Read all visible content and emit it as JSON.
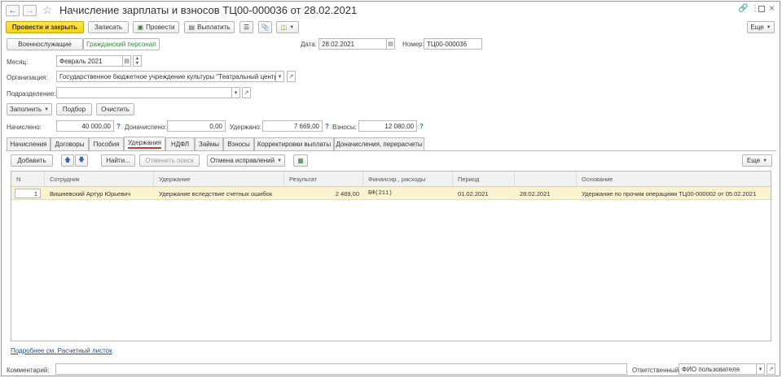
{
  "window": {
    "title": "Начисление зарплаты и взносов ТЦ00-000036 от 28.02.2021"
  },
  "toolbar": {
    "post_close": "Провести и закрыть",
    "save": "Записать",
    "post": "Провести",
    "pay": "Выплатить",
    "more": "Еще"
  },
  "personnel_tabs": {
    "military": "Военнослужащие",
    "civil": "Гражданский персонал"
  },
  "header": {
    "date_label": "Дата:",
    "date_value": "28.02.2021",
    "number_label": "Номер:",
    "number_value": "ТЦ00-000036",
    "month_label": "Месяц:",
    "month_value": "Февраль 2021",
    "org_label": "Организация:",
    "org_value": "Государственное бюджетное учреждение культуры \"Театральный центр\"",
    "dept_label": "Подразделение:",
    "dept_value": ""
  },
  "actions": {
    "fill": "Заполнить",
    "pick": "Подбор",
    "clear": "Очистить"
  },
  "totals": {
    "accrued_label": "Начислено:",
    "accrued_value": "40 000,00",
    "extra_label": "Доначислено:",
    "extra_value": "0,00",
    "withheld_label": "Удержано:",
    "withheld_value": "7 669,00",
    "contrib_label": "Взносы:",
    "contrib_value": "12 080,00",
    "help": "?"
  },
  "tabs": [
    {
      "label": "Начисления"
    },
    {
      "label": "Договоры"
    },
    {
      "label": "Пособия"
    },
    {
      "label": "Удержания"
    },
    {
      "label": "НДФЛ"
    },
    {
      "label": "Займы"
    },
    {
      "label": "Взносы"
    },
    {
      "label": "Корректировки выплаты"
    },
    {
      "label": "Доначисления, перерасчеты"
    }
  ],
  "active_tab": "Удержания",
  "tab_toolbar": {
    "add": "Добавить",
    "find": "Найти...",
    "cancel_search": "Отменить поиск",
    "cancel_corrections": "Отмена исправлений",
    "more": "Еще"
  },
  "table": {
    "columns": [
      "N",
      "Сотрудник",
      "Удержание",
      "Результат",
      "Финансир., расходы",
      "Период",
      "",
      "Основание"
    ],
    "rows": [
      {
        "n": "1",
        "employee": "Вишневский Артур Юрьевич",
        "deduction": "Удержание вследствие счетных ошибок",
        "result": "2 469,00",
        "financing": "БФ(211)",
        "period_from": "01.02.2021",
        "period_to": "28.02.2021",
        "basis": "Удержание по прочим операциям ТЦ00-000002 от 05.02.2021"
      }
    ]
  },
  "footer": {
    "details_link": "Подробнее см. Расчетный листок",
    "comment_label": "Комментарий:",
    "comment_value": "",
    "responsible_label": "Ответственный:",
    "responsible_value": "ФИО пользователя"
  },
  "colors": {
    "primary_button": "#f4d21a",
    "active_tab_underline": "#d43a2a",
    "selected_row": "#fbf3cf",
    "link": "#1a4f9c",
    "civil_tab_text": "#2e8b3a"
  }
}
